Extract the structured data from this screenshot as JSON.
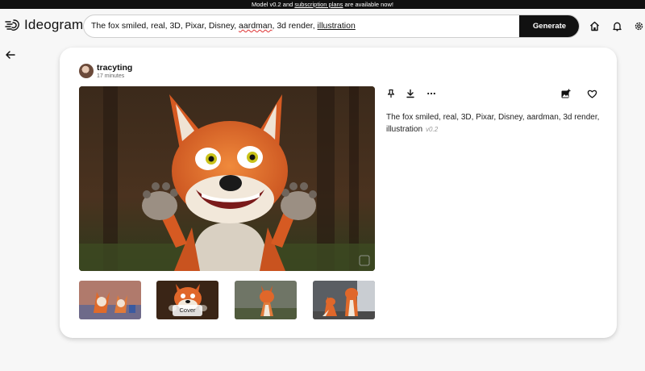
{
  "banner": {
    "prefix": "Model v0.2 and ",
    "link": "subscription plans",
    "suffix": " are available now!"
  },
  "brand": {
    "name": "Ideogram"
  },
  "search": {
    "part1": "The fox smiled, real, 3D, Pixar, Disney, ",
    "part2": "aardman",
    "part3": ", 3d render, ",
    "part4": "illustration",
    "generate_label": "Generate"
  },
  "header_icons": [
    "home-icon",
    "bell-icon",
    "settings-icon"
  ],
  "post": {
    "username": "tracyting",
    "time": "17 minutes",
    "prompt": "The fox smiled, real, 3D, Pixar, Disney, aardman, 3d render, illustration",
    "version": "v0.2",
    "cover_label": "Cover"
  },
  "actions": [
    "pin-icon",
    "download-icon",
    "more-icon",
    "add-image-icon",
    "heart-icon"
  ],
  "colors": {
    "accent": "#111111",
    "fox": "#e0672a"
  }
}
